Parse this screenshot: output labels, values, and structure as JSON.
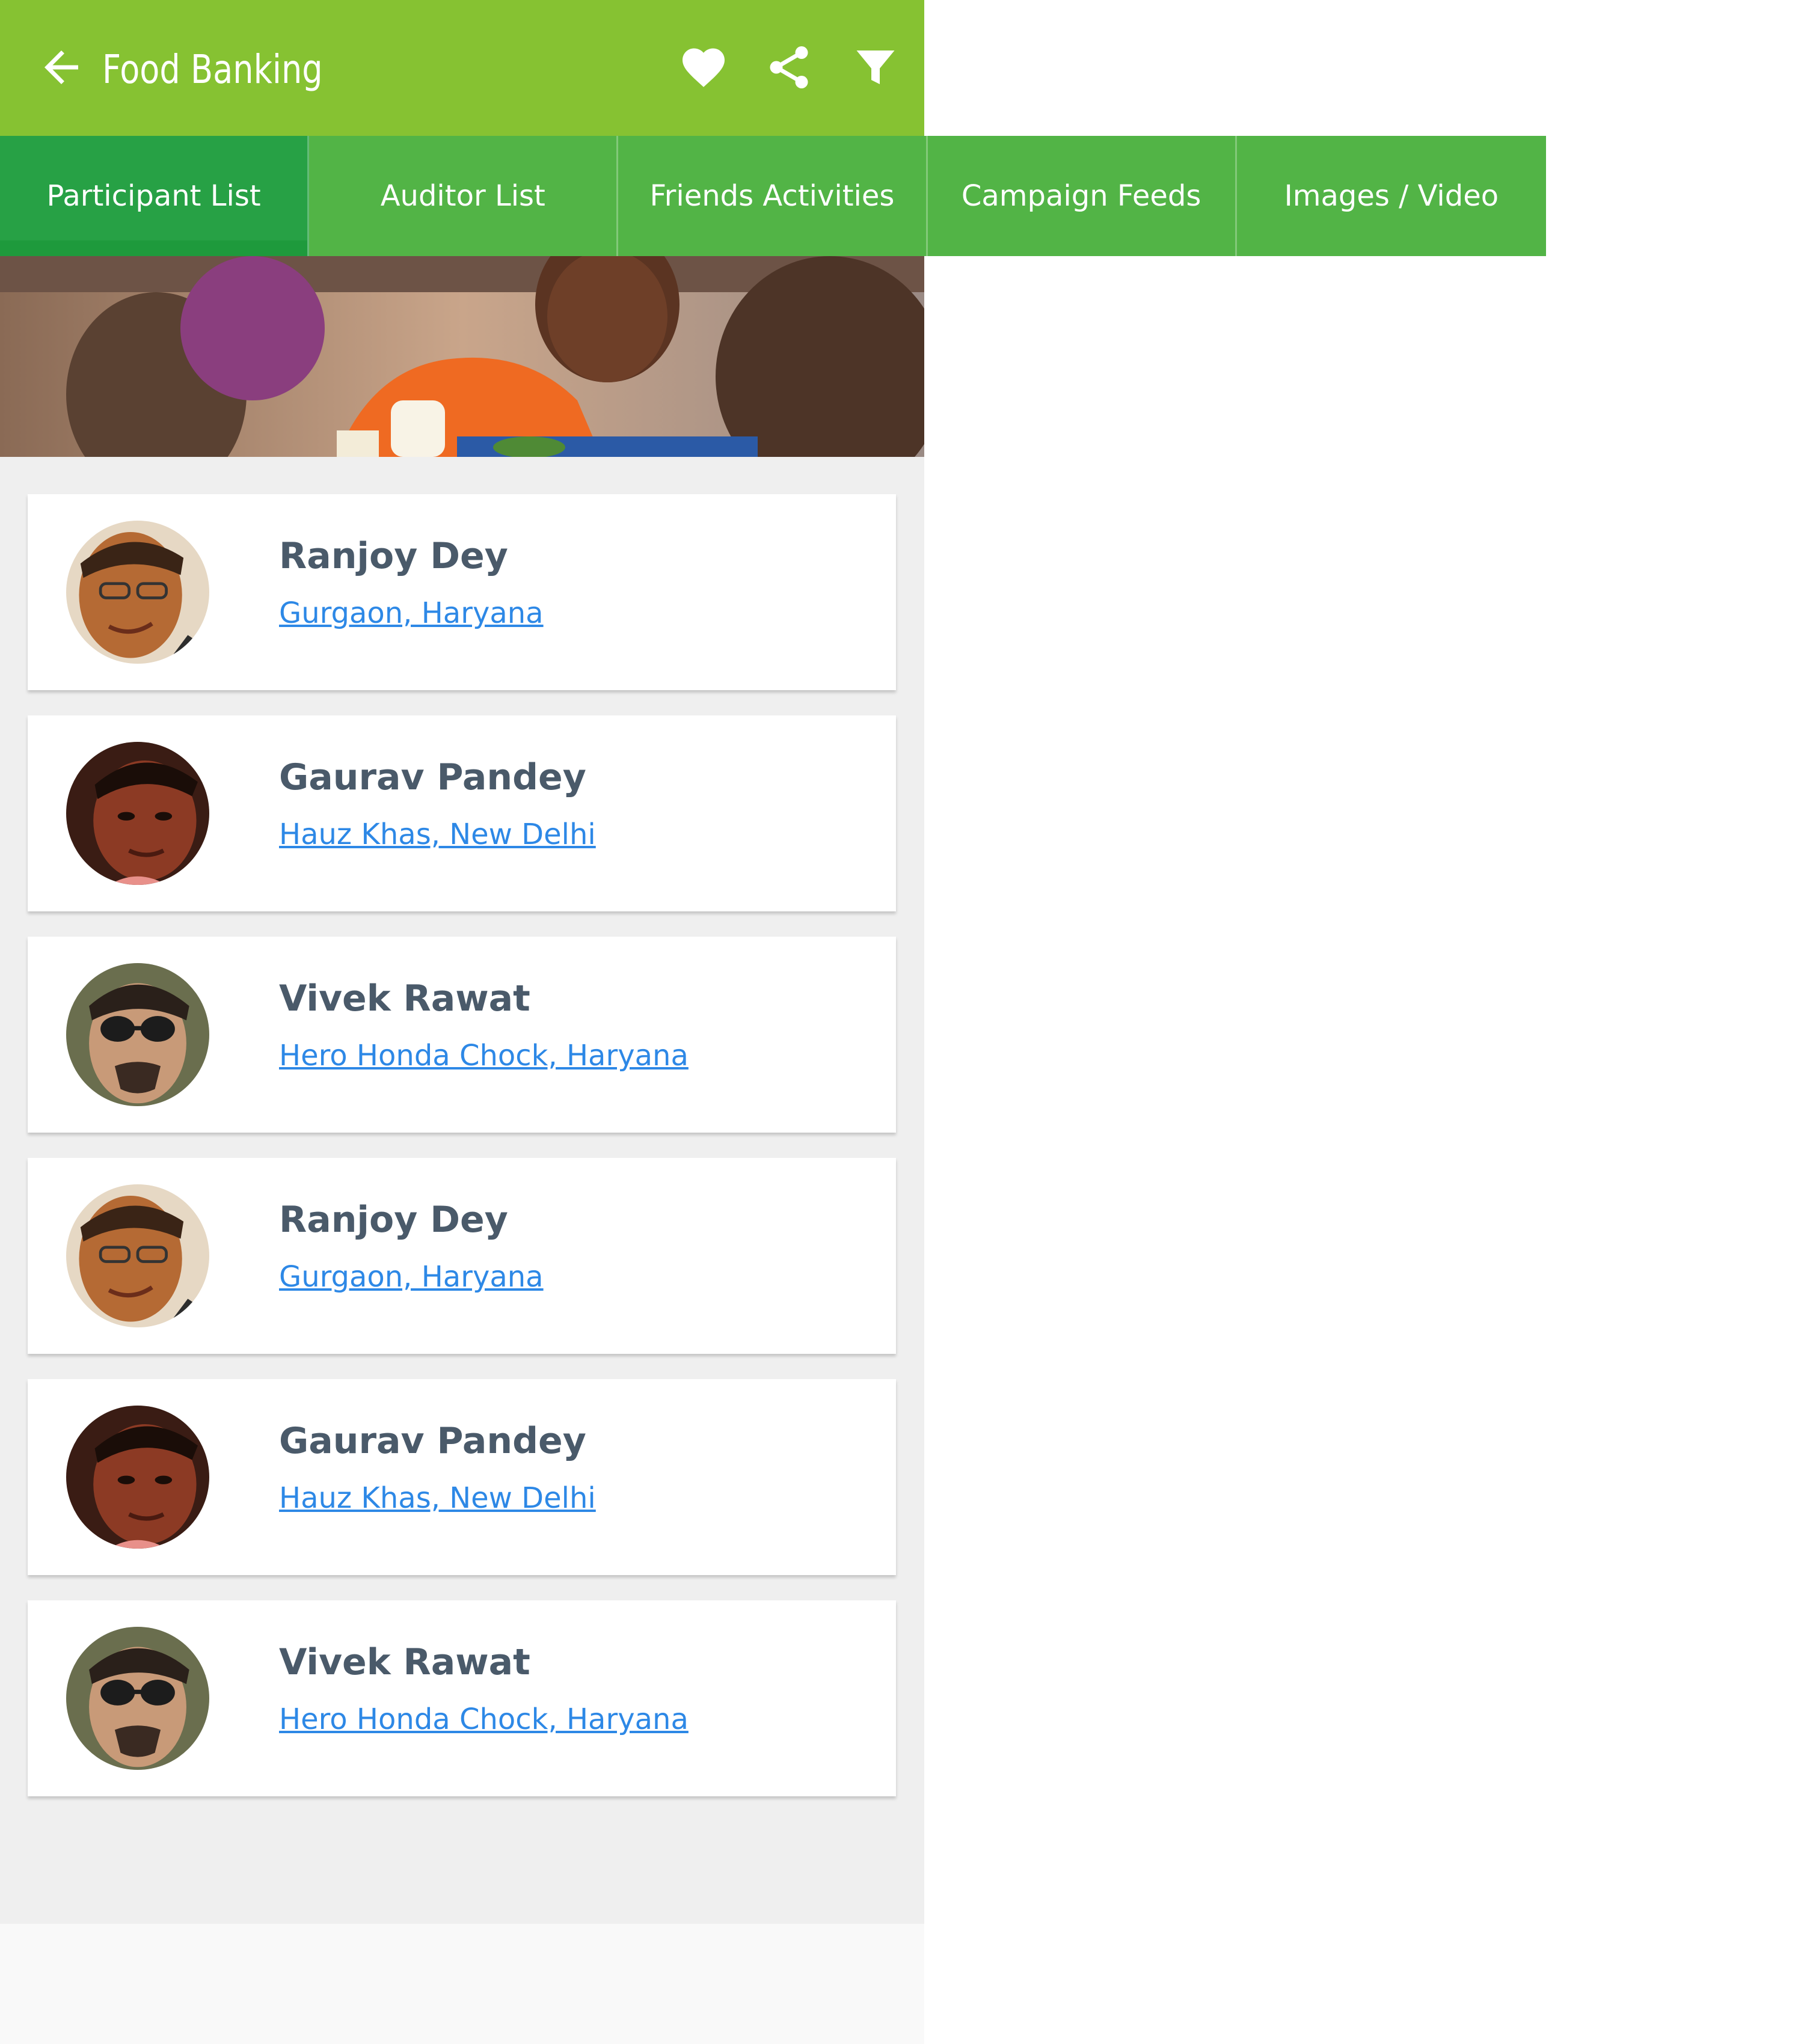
{
  "appbar": {
    "title": "Food Banking",
    "back_icon": "arrow-left-icon",
    "actions": [
      "heart-icon",
      "share-icon",
      "filter-icon"
    ],
    "color": "#86c232"
  },
  "tabs": [
    {
      "label": "Participant List",
      "active": true
    },
    {
      "label": "Auditor List",
      "active": false
    },
    {
      "label": "Friends Activities",
      "active": false
    },
    {
      "label": "Campaign Feeds",
      "active": false
    },
    {
      "label": "Images / Video",
      "active": false
    }
  ],
  "participants": [
    {
      "name": "Ranjoy Dey",
      "location": "Gurgaon, Haryana"
    },
    {
      "name": "Gaurav Pandey",
      "location": "Hauz Khas, New Delhi"
    },
    {
      "name": "Vivek Rawat",
      "location": "Hero Honda Chock, Haryana"
    },
    {
      "name": "Ranjoy Dey",
      "location": "Gurgaon, Haryana"
    },
    {
      "name": "Gaurav Pandey",
      "location": "Hauz Khas, New Delhi"
    },
    {
      "name": "Vivek Rawat",
      "location": "Hero Honda Chock, Haryana"
    }
  ],
  "colors": {
    "tab_bar": "#52b446",
    "tab_active": "#27a145",
    "name_text": "#4a5a6a",
    "link_text": "#2d88e6"
  }
}
